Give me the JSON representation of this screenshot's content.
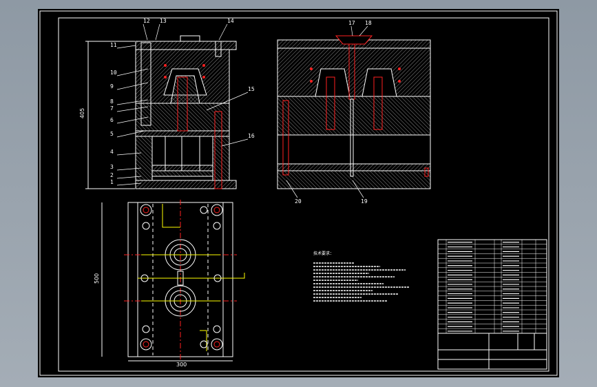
{
  "colors": {
    "background": "#000000",
    "frame": "#ffffff",
    "outline": "#ffffff",
    "hatch": "#8a8a8a",
    "red": "#ff2020",
    "yellow": "#ffff00",
    "magenta": "#ff30ff",
    "cyan": "#00ffff"
  },
  "section_left": {
    "part_numbers": [
      "1",
      "2",
      "3",
      "4",
      "5",
      "6",
      "7",
      "8",
      "9",
      "10",
      "11",
      "12",
      "13",
      "14",
      "15",
      "16"
    ],
    "height_dim": "405"
  },
  "section_right": {
    "part_numbers": [
      "17",
      "18",
      "19",
      "20"
    ]
  },
  "plan_view": {
    "height_dim": "500",
    "width_dim": "300"
  },
  "notes": {
    "heading": "技术要求："
  },
  "title_block": {
    "bom_rows": 20
  }
}
